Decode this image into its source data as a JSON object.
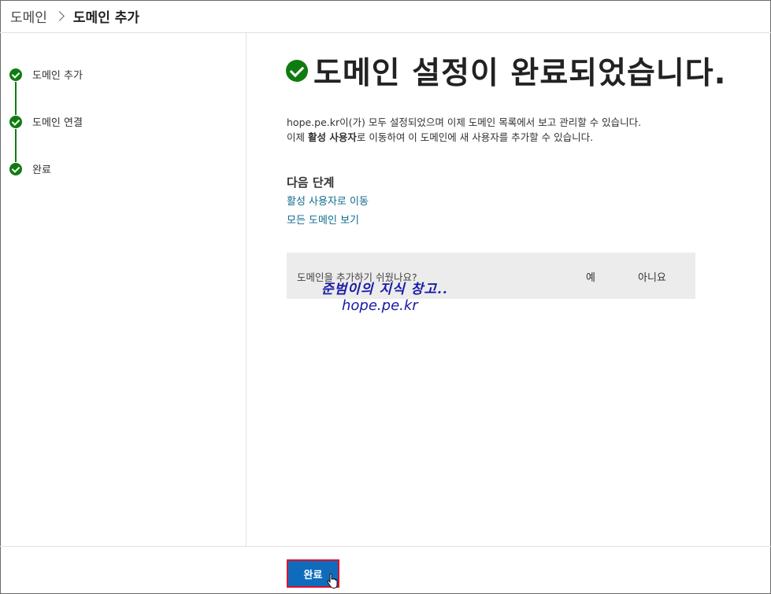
{
  "breadcrumb": {
    "root": "도메인",
    "current": "도메인 추가"
  },
  "steps": [
    {
      "label": "도메인 추가"
    },
    {
      "label": "도메인 연결"
    },
    {
      "label": "완료"
    }
  ],
  "main": {
    "title": "도메인 설정이 완료되었습니다.",
    "desc_line1": "hope.pe.kr이(가) 모두 설정되었으며 이제 도메인 목록에서 보고 관리할 수 있습니다.",
    "desc_line2_pre": "이제 ",
    "desc_line2_bold": "활성 사용자",
    "desc_line2_post": "로 이동하여 이 도메인에 새 사용자를 추가할 수 있습니다.",
    "next_steps_heading": "다음 단계",
    "link_active_users": "활성 사용자로 이동",
    "link_all_domains": "모든 도메인 보기",
    "feedback": {
      "question": "도메인을 추가하기 쉬웠나요?",
      "yes": "예",
      "no": "아니요"
    },
    "watermark_line1": "준범이의 지식 창고..",
    "watermark_line2": "hope.pe.kr"
  },
  "footer": {
    "done_label": "완료"
  },
  "colors": {
    "success": "#107c10",
    "link": "#0f6b8f",
    "primary": "#0f6cbd",
    "highlight_border": "#e0102a"
  }
}
